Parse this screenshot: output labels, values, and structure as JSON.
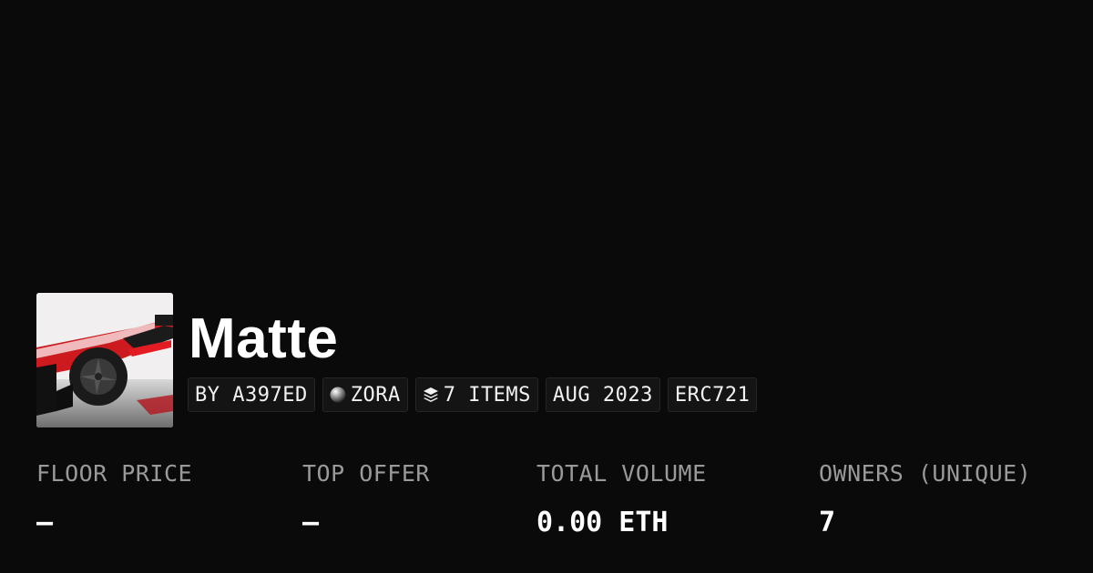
{
  "collection": {
    "name": "Matte",
    "thumbnail_icon": "race-car-image"
  },
  "badges": {
    "creator": "BY A397ED",
    "chain": "ZORA",
    "chain_icon": "zora-orb-icon",
    "items": "7 ITEMS",
    "items_icon": "layers-icon",
    "date": "AUG 2023",
    "standard": "ERC721"
  },
  "stats": [
    {
      "label": "FLOOR PRICE",
      "value": "–"
    },
    {
      "label": "TOP OFFER",
      "value": "–"
    },
    {
      "label": "TOTAL VOLUME",
      "value": "0.00 ETH"
    },
    {
      "label": "OWNERS (UNIQUE)",
      "value": "7"
    }
  ],
  "colors": {
    "background": "#0a0a0a",
    "badge_bg": "#141414",
    "label": "#9a9a9a",
    "text": "#ffffff"
  }
}
